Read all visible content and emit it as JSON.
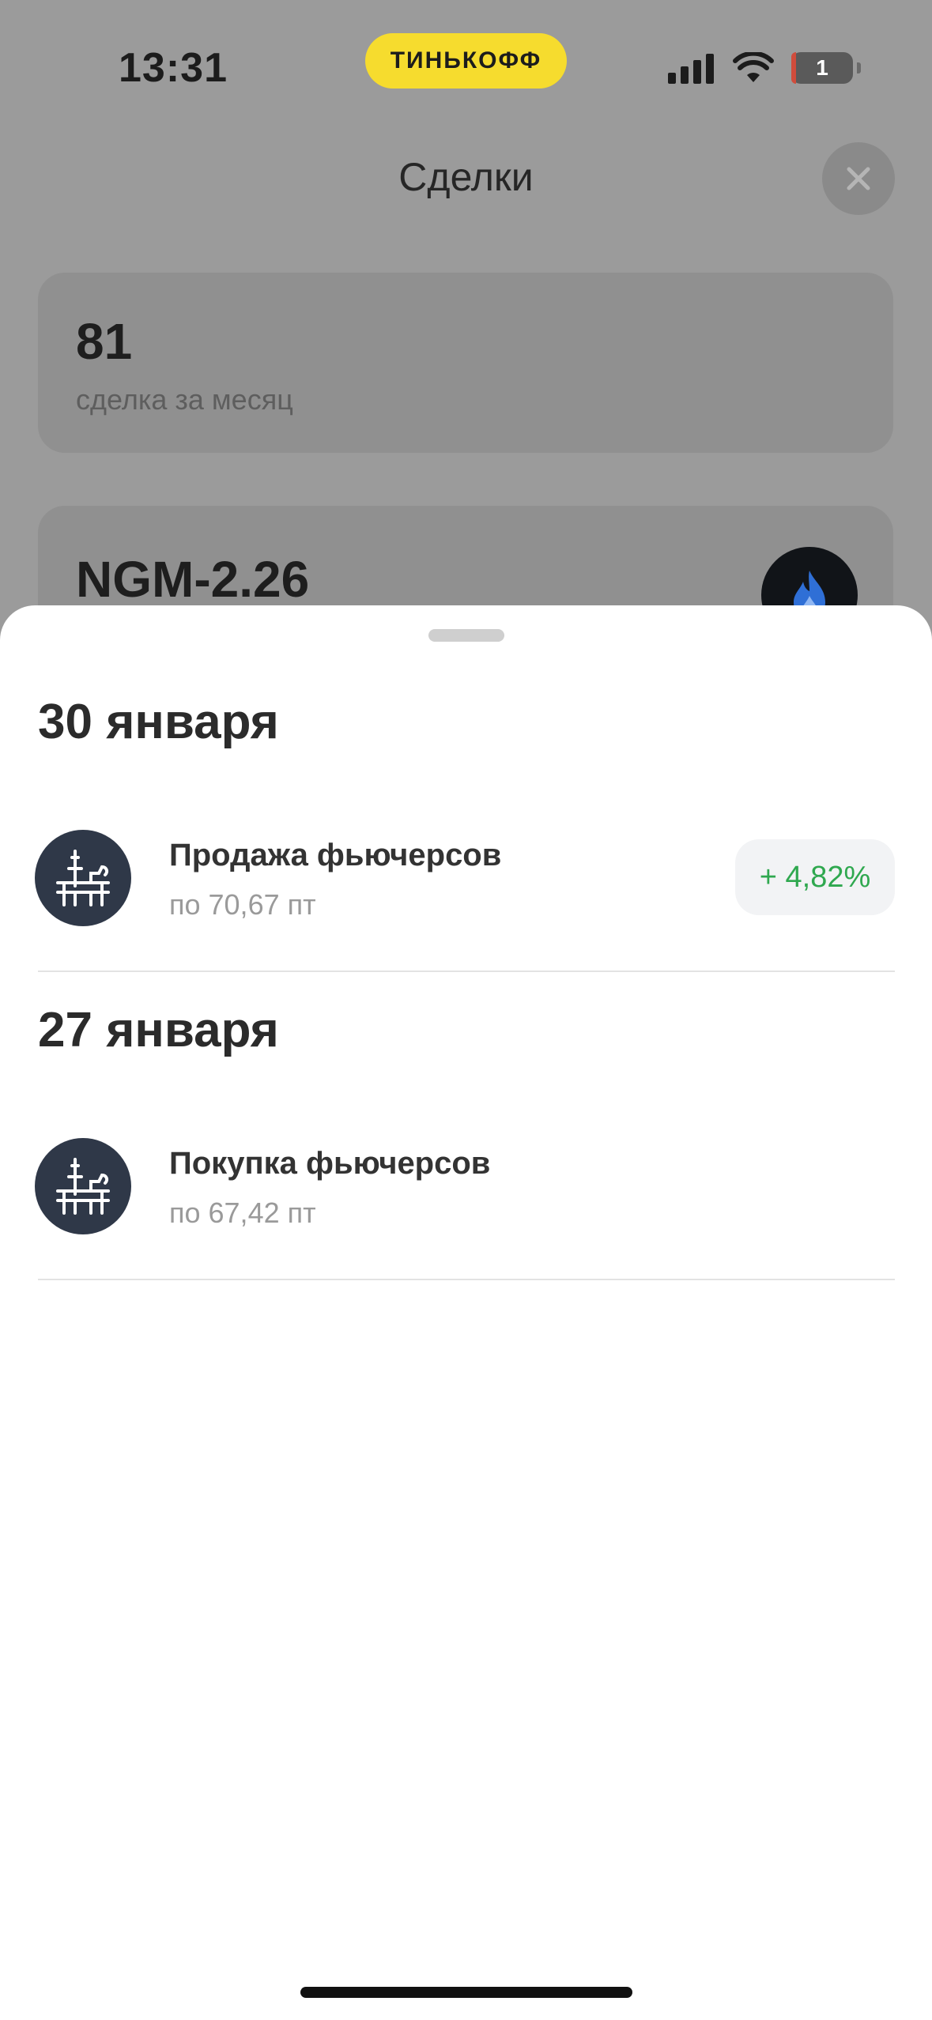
{
  "status_bar": {
    "time": "13:31",
    "brand": "ТИНЬКОФФ",
    "battery": "1",
    "colors": {
      "brand_pill": "#f6dc2e",
      "battery_low": "#d04c3c"
    }
  },
  "screen": {
    "title": "Сделки",
    "close_icon": "close-icon",
    "stats": {
      "value": "81",
      "label": "сделка за месяц"
    },
    "instrument": {
      "ticker": "NGM-2.26",
      "logo_icon": "gas-flame-icon"
    }
  },
  "sheet": {
    "groups": [
      {
        "date": "30 января",
        "deals": [
          {
            "title": "Продажа фьючерсов",
            "subtitle": "по 70,67 пт",
            "profit": "+ 4,82%",
            "icon": "oil-platform-icon"
          }
        ]
      },
      {
        "date": "27 января",
        "deals": [
          {
            "title": "Покупка фьючерсов",
            "subtitle": "по 67,42 пт",
            "icon": "oil-platform-icon"
          }
        ]
      }
    ],
    "colors": {
      "profit_text": "#2fa84f",
      "avatar_bg": "#2f3848"
    }
  }
}
